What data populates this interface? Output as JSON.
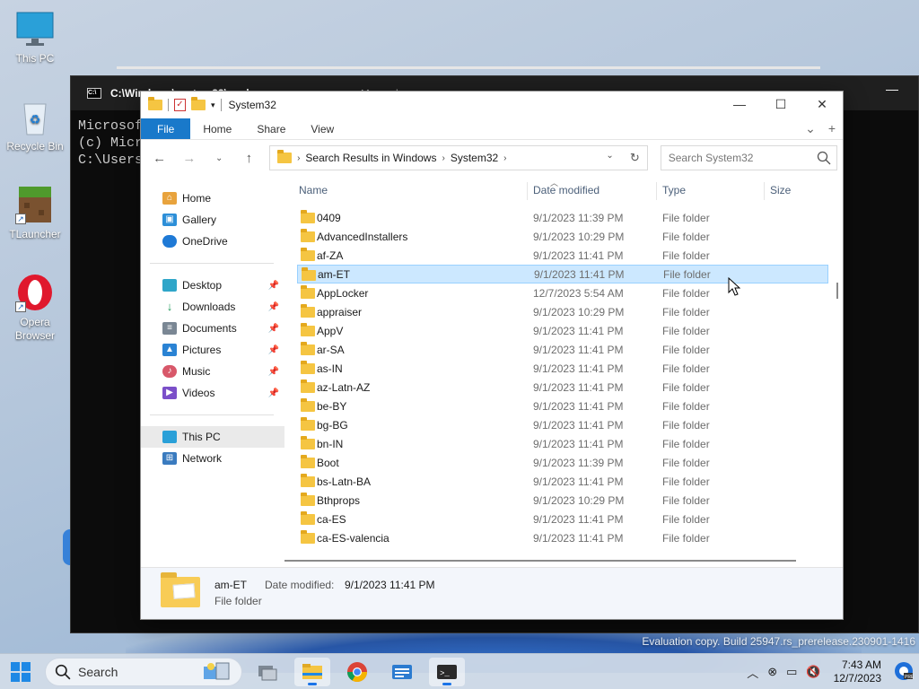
{
  "desktop": {
    "icons": [
      {
        "label": "This PC"
      },
      {
        "label": "Recycle Bin"
      },
      {
        "label": "TLauncher"
      },
      {
        "label": "Opera Browser"
      }
    ]
  },
  "console": {
    "title": "C:\\Windows\\system32\\cmd.exe",
    "lines": [
      "Microsof",
      "(c) Micr",
      "",
      "C:\\Users"
    ]
  },
  "explorer": {
    "title": "System32",
    "ribbon_tabs": [
      "File",
      "Home",
      "Share",
      "View"
    ],
    "breadcrumb": [
      "Search Results in Windows",
      "System32"
    ],
    "search_placeholder": "Search System32",
    "nav": {
      "top": [
        "Home",
        "Gallery",
        "OneDrive"
      ],
      "quick": [
        "Desktop",
        "Downloads",
        "Documents",
        "Pictures",
        "Music",
        "Videos"
      ],
      "bottom": [
        "This PC",
        "Network"
      ]
    },
    "columns": [
      "Name",
      "Date modified",
      "Type",
      "Size"
    ],
    "rows": [
      {
        "name": "0409",
        "date": "9/1/2023 11:39 PM",
        "type": "File folder"
      },
      {
        "name": "AdvancedInstallers",
        "date": "9/1/2023 10:29 PM",
        "type": "File folder"
      },
      {
        "name": "af-ZA",
        "date": "9/1/2023 11:41 PM",
        "type": "File folder"
      },
      {
        "name": "am-ET",
        "date": "9/1/2023 11:41 PM",
        "type": "File folder",
        "selected": true
      },
      {
        "name": "AppLocker",
        "date": "12/7/2023 5:54 AM",
        "type": "File folder"
      },
      {
        "name": "appraiser",
        "date": "9/1/2023 10:29 PM",
        "type": "File folder"
      },
      {
        "name": "AppV",
        "date": "9/1/2023 11:41 PM",
        "type": "File folder"
      },
      {
        "name": "ar-SA",
        "date": "9/1/2023 11:41 PM",
        "type": "File folder"
      },
      {
        "name": "as-IN",
        "date": "9/1/2023 11:41 PM",
        "type": "File folder"
      },
      {
        "name": "az-Latn-AZ",
        "date": "9/1/2023 11:41 PM",
        "type": "File folder"
      },
      {
        "name": "be-BY",
        "date": "9/1/2023 11:41 PM",
        "type": "File folder"
      },
      {
        "name": "bg-BG",
        "date": "9/1/2023 11:41 PM",
        "type": "File folder"
      },
      {
        "name": "bn-IN",
        "date": "9/1/2023 11:41 PM",
        "type": "File folder"
      },
      {
        "name": "Boot",
        "date": "9/1/2023 11:39 PM",
        "type": "File folder"
      },
      {
        "name": "bs-Latn-BA",
        "date": "9/1/2023 11:41 PM",
        "type": "File folder"
      },
      {
        "name": "Bthprops",
        "date": "9/1/2023 10:29 PM",
        "type": "File folder"
      },
      {
        "name": "ca-ES",
        "date": "9/1/2023 11:41 PM",
        "type": "File folder"
      },
      {
        "name": "ca-ES-valencia",
        "date": "9/1/2023 11:41 PM",
        "type": "File folder"
      }
    ],
    "details": {
      "name": "am-ET",
      "type": "File folder",
      "date_label": "Date modified:",
      "date_value": "9/1/2023 11:41 PM"
    }
  },
  "watermark": "Evaluation copy. Build 25947.rs_prerelease.230901-1416",
  "taskbar": {
    "search_label": "Search",
    "time": "7:43 AM",
    "date": "12/7/2023"
  },
  "colors": {
    "accent": "#1979ca",
    "selection": "#cce8ff",
    "folder": "#f5c542"
  }
}
